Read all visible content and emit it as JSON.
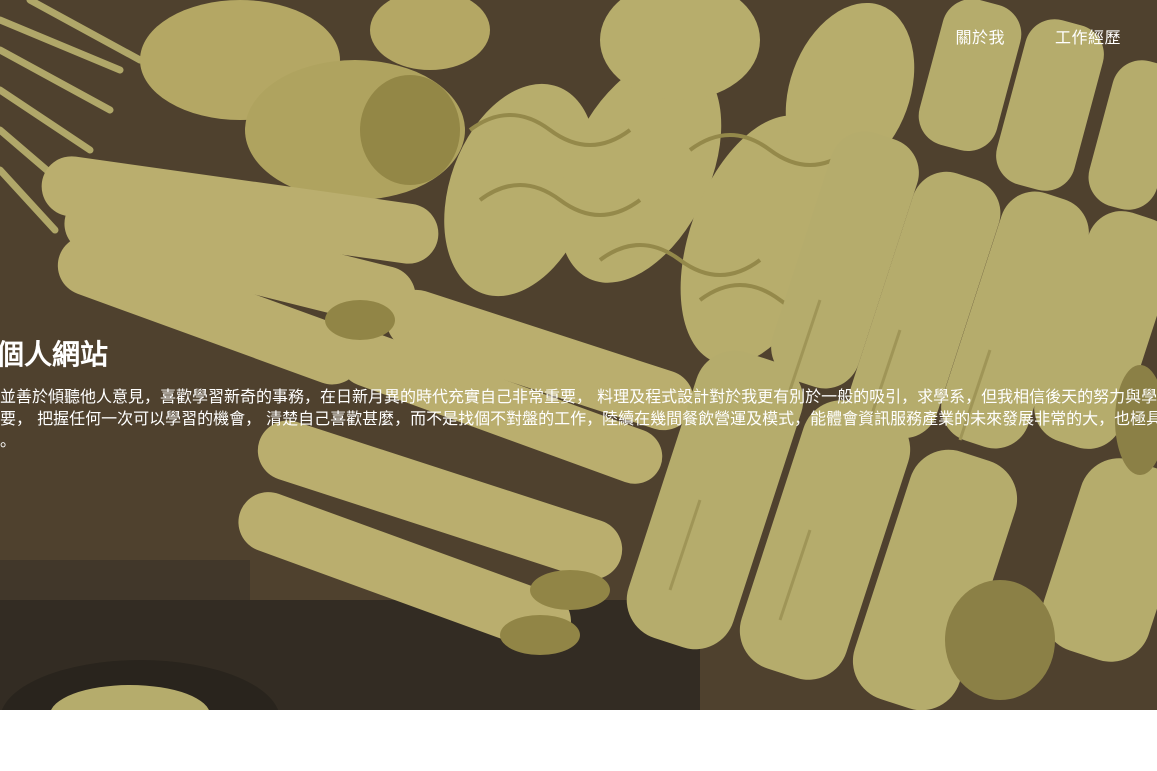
{
  "nav": {
    "items": [
      {
        "label": "關於我"
      },
      {
        "label": "工作經歷"
      }
    ]
  },
  "hero": {
    "title": "的個人網站",
    "paragraph": "慢熱並善於傾聽他人意見，喜歡學習新奇的事務，在日新月異的時代充實自己非常重要， 料理及程式設計對於我更有別於一般的吸引，求學系，但我相信後天的努力與學習更重要， 把握任何一次可以學習的機會， 清楚自己喜歡甚麼，而不是找個不對盤的工作，陸續在幾間餐飲營運及模式，能體會資訊服務產業的未來發展非常的大，也極具挑戰力。"
  },
  "colors": {
    "hero_text": "#ffffff",
    "hero_bg": "#4e4733"
  }
}
